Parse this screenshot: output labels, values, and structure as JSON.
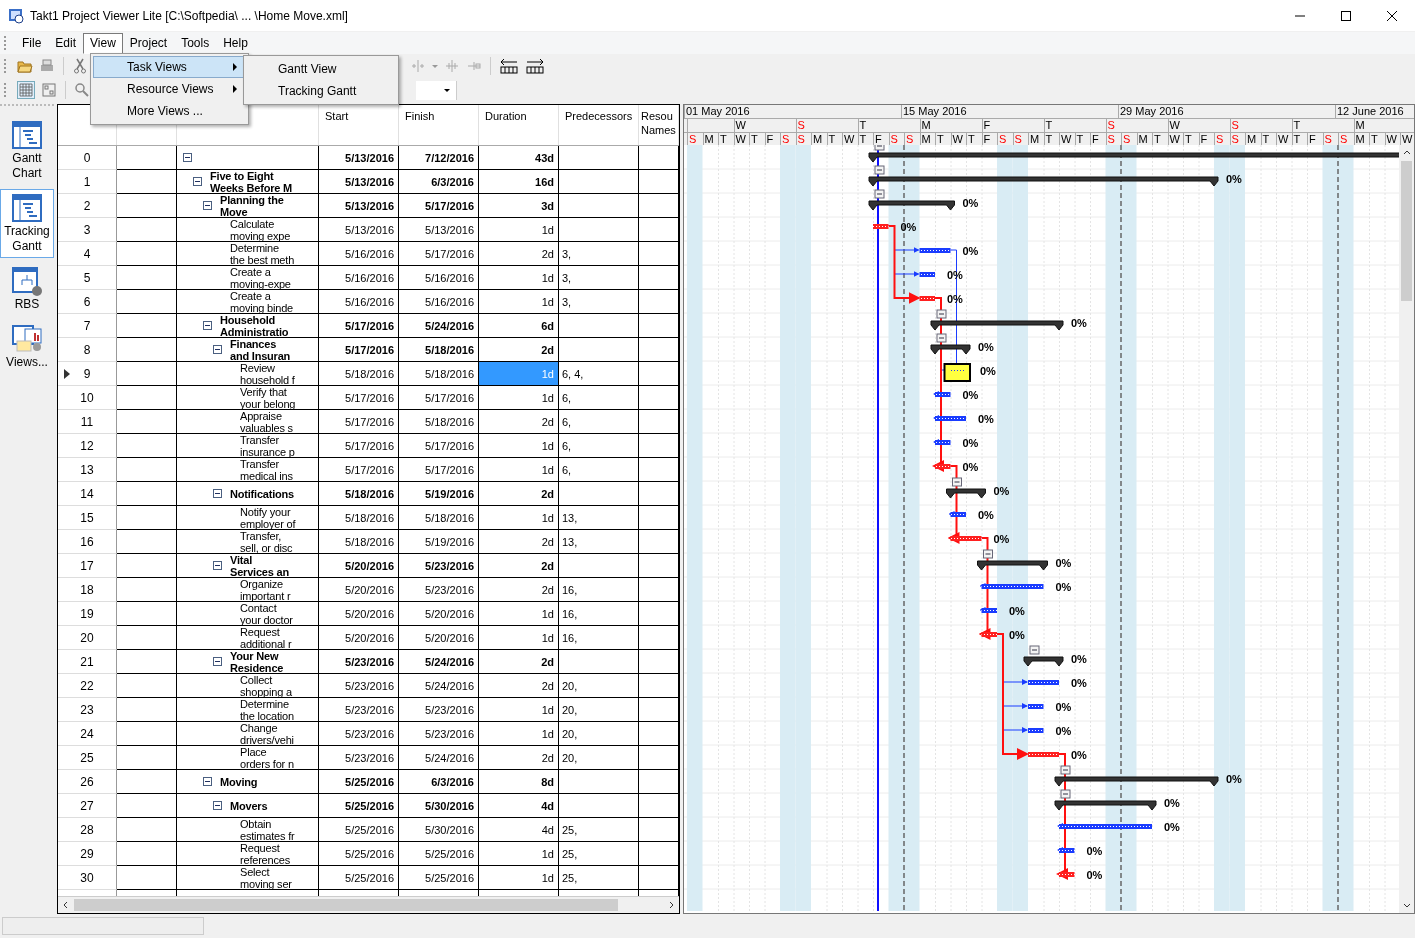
{
  "window": {
    "title": "Takt1 Project Viewer Lite [C:\\Softpedia\\ ... \\Home Move.xml]"
  },
  "menu": [
    {
      "label": "File",
      "selected": false
    },
    {
      "label": "Edit",
      "selected": false
    },
    {
      "label": "View",
      "selected": true
    },
    {
      "label": "Project",
      "selected": false
    },
    {
      "label": "Tools",
      "selected": false
    },
    {
      "label": "Help",
      "selected": false
    }
  ],
  "view_menu": [
    {
      "label": "Task Views",
      "selected": true,
      "submenu": true
    },
    {
      "label": "Resource Views",
      "selected": false,
      "submenu": true
    },
    {
      "label": "More Views ...",
      "selected": false,
      "submenu": false
    }
  ],
  "task_views_submenu": [
    "Gantt View",
    "Tracking Gantt"
  ],
  "sidebar": [
    {
      "label": "Gantt Chart",
      "selected": false
    },
    {
      "label": "Tracking Gantt",
      "selected": true
    },
    {
      "label": "RBS",
      "selected": false
    },
    {
      "label": "Views...",
      "selected": false
    }
  ],
  "table": {
    "columns": [
      "Start",
      "Finish",
      "Duration",
      "Predecessors",
      "Resou\nNames"
    ],
    "rows": [
      {
        "id": "0",
        "kind": "summary",
        "start": "5/13/2016",
        "finish": "7/12/2016",
        "duration": "43d",
        "selected": false,
        "children": [
          {
            "id": "1",
            "kind": "summary",
            "name": "Five to Eight\nWeeks Before M",
            "start": "5/13/2016",
            "finish": "6/3/2016",
            "duration": "16d",
            "progress": "0%",
            "selected": false,
            "children": [
              {
                "id": "2",
                "kind": "summary",
                "name": "Planning the\nMove",
                "start": "5/13/2016",
                "finish": "5/17/2016",
                "duration": "3d",
                "progress": "0%",
                "selected": false,
                "children": [
                  {
                    "id": "3",
                    "kind": "task",
                    "name": "Calculate\nmoving expe",
                    "start": "5/13/2016",
                    "finish": "5/13/2016",
                    "duration": "1d",
                    "progress": "0%",
                    "critical": true,
                    "selected": false
                  },
                  {
                    "id": "4",
                    "kind": "task",
                    "name": "Determine\nthe best meth",
                    "start": "5/16/2016",
                    "finish": "5/17/2016",
                    "duration": "2d",
                    "predecessors": "3,",
                    "progress": "0%",
                    "critical": false,
                    "selected": false
                  },
                  {
                    "id": "5",
                    "kind": "task",
                    "name": "Create a\nmoving-expe",
                    "start": "5/16/2016",
                    "finish": "5/16/2016",
                    "duration": "1d",
                    "predecessors": "3,",
                    "progress": "0%",
                    "critical": false,
                    "selected": false
                  },
                  {
                    "id": "6",
                    "kind": "task",
                    "name": "Create a\nmoving binde",
                    "start": "5/16/2016",
                    "finish": "5/16/2016",
                    "duration": "1d",
                    "predecessors": "3,",
                    "progress": "0%",
                    "critical": true,
                    "selected": false
                  }
                ]
              },
              {
                "id": "7",
                "kind": "summary",
                "name": "Household\nAdministratio",
                "start": "5/17/2016",
                "finish": "5/24/2016",
                "duration": "6d",
                "progress": "0%",
                "selected": false,
                "children": [
                  {
                    "id": "8",
                    "kind": "summary",
                    "name": "Finances\nand Insuran",
                    "start": "5/17/2016",
                    "finish": "5/18/2016",
                    "duration": "2d",
                    "progress": "0%",
                    "selected": false,
                    "children": [
                      {
                        "id": "9",
                        "kind": "task",
                        "name": "Review\nhousehold f",
                        "start": "5/18/2016",
                        "finish": "5/18/2016",
                        "duration": "1d",
                        "predecessors": "6, 4,",
                        "progress": "0%",
                        "critical": false,
                        "selected": true
                      },
                      {
                        "id": "10",
                        "kind": "task",
                        "name": "Verify that\nyour belong",
                        "start": "5/17/2016",
                        "finish": "5/17/2016",
                        "duration": "1d",
                        "predecessors": "6,",
                        "progress": "0%",
                        "critical": false,
                        "selected": false
                      },
                      {
                        "id": "11",
                        "kind": "task",
                        "name": "Appraise\nvaluables s",
                        "start": "5/17/2016",
                        "finish": "5/18/2016",
                        "duration": "2d",
                        "predecessors": "6,",
                        "progress": "0%",
                        "critical": false,
                        "selected": false
                      },
                      {
                        "id": "12",
                        "kind": "task",
                        "name": "Transfer\ninsurance p",
                        "start": "5/17/2016",
                        "finish": "5/17/2016",
                        "duration": "1d",
                        "predecessors": "6,",
                        "progress": "0%",
                        "critical": false,
                        "selected": false
                      },
                      {
                        "id": "13",
                        "kind": "task",
                        "name": "Transfer\nmedical ins",
                        "start": "5/17/2016",
                        "finish": "5/17/2016",
                        "duration": "1d",
                        "predecessors": "6,",
                        "progress": "0%",
                        "critical": true,
                        "selected": false
                      }
                    ]
                  },
                  {
                    "id": "14",
                    "kind": "summary",
                    "name": "Notifications",
                    "start": "5/18/2016",
                    "finish": "5/19/2016",
                    "duration": "2d",
                    "progress": "0%",
                    "selected": false,
                    "children": [
                      {
                        "id": "15",
                        "kind": "task",
                        "name": "Notify your\nemployer of",
                        "start": "5/18/2016",
                        "finish": "5/18/2016",
                        "duration": "1d",
                        "predecessors": "13,",
                        "progress": "0%",
                        "critical": false,
                        "selected": false
                      },
                      {
                        "id": "16",
                        "kind": "task",
                        "name": "Transfer,\nsell, or disc",
                        "start": "5/18/2016",
                        "finish": "5/19/2016",
                        "duration": "2d",
                        "predecessors": "13,",
                        "progress": "0%",
                        "critical": true,
                        "selected": false
                      }
                    ]
                  },
                  {
                    "id": "17",
                    "kind": "summary",
                    "name": "Vital\nServices an",
                    "start": "5/20/2016",
                    "finish": "5/23/2016",
                    "duration": "2d",
                    "progress": "0%",
                    "selected": false,
                    "children": [
                      {
                        "id": "18",
                        "kind": "task",
                        "name": "Organize\nimportant r",
                        "start": "5/20/2016",
                        "finish": "5/23/2016",
                        "duration": "2d",
                        "predecessors": "16,",
                        "progress": "0%",
                        "critical": false,
                        "selected": false
                      },
                      {
                        "id": "19",
                        "kind": "task",
                        "name": "Contact\nyour doctor",
                        "start": "5/20/2016",
                        "finish": "5/20/2016",
                        "duration": "1d",
                        "predecessors": "16,",
                        "progress": "0%",
                        "critical": false,
                        "selected": false
                      },
                      {
                        "id": "20",
                        "kind": "task",
                        "name": "Request\nadditional r",
                        "start": "5/20/2016",
                        "finish": "5/20/2016",
                        "duration": "1d",
                        "predecessors": "16,",
                        "progress": "0%",
                        "critical": true,
                        "selected": false
                      }
                    ]
                  },
                  {
                    "id": "21",
                    "kind": "summary",
                    "name": "Your New\nResidence",
                    "start": "5/23/2016",
                    "finish": "5/24/2016",
                    "duration": "2d",
                    "progress": "0%",
                    "selected": false,
                    "children": [
                      {
                        "id": "22",
                        "kind": "task",
                        "name": "Collect\nshopping a",
                        "start": "5/23/2016",
                        "finish": "5/24/2016",
                        "duration": "2d",
                        "predecessors": "20,",
                        "progress": "0%",
                        "critical": false,
                        "selected": false
                      },
                      {
                        "id": "23",
                        "kind": "task",
                        "name": "Determine\nthe location",
                        "start": "5/23/2016",
                        "finish": "5/23/2016",
                        "duration": "1d",
                        "predecessors": "20,",
                        "progress": "0%",
                        "critical": false,
                        "selected": false
                      },
                      {
                        "id": "24",
                        "kind": "task",
                        "name": "Change\ndrivers/vehi",
                        "start": "5/23/2016",
                        "finish": "5/23/2016",
                        "duration": "1d",
                        "predecessors": "20,",
                        "progress": "0%",
                        "critical": false,
                        "selected": false
                      },
                      {
                        "id": "25",
                        "kind": "task",
                        "name": "Place\norders for n",
                        "start": "5/23/2016",
                        "finish": "5/24/2016",
                        "duration": "2d",
                        "predecessors": "20,",
                        "progress": "0%",
                        "critical": true,
                        "selected": false
                      }
                    ]
                  }
                ]
              },
              {
                "id": "26",
                "kind": "summary",
                "name": "Moving",
                "start": "5/25/2016",
                "finish": "6/3/2016",
                "duration": "8d",
                "progress": "0%",
                "selected": false,
                "children": [
                  {
                    "id": "27",
                    "kind": "summary",
                    "name": "Movers",
                    "start": "5/25/2016",
                    "finish": "5/30/2016",
                    "duration": "4d",
                    "progress": "0%",
                    "selected": false,
                    "children": [
                      {
                        "id": "28",
                        "kind": "task",
                        "name": "Obtain\nestimates fr",
                        "start": "5/25/2016",
                        "finish": "5/30/2016",
                        "duration": "4d",
                        "predecessors": "25,",
                        "progress": "0%",
                        "critical": false,
                        "selected": false
                      },
                      {
                        "id": "29",
                        "kind": "task",
                        "name": "Request\nreferences",
                        "start": "5/25/2016",
                        "finish": "5/25/2016",
                        "duration": "1d",
                        "predecessors": "25,",
                        "progress": "0%",
                        "critical": false,
                        "selected": false
                      },
                      {
                        "id": "30",
                        "kind": "task",
                        "name": "Select\nmoving ser",
                        "start": "5/25/2016",
                        "finish": "5/25/2016",
                        "duration": "1d",
                        "predecessors": "25,",
                        "progress": "0%",
                        "critical": true,
                        "selected": false
                      }
                    ]
                  }
                ]
              }
            ]
          }
        ]
      }
    ]
  },
  "gantt": {
    "months": [
      "01 May 2016",
      "15 May 2016",
      "29 May 2016",
      "12 June 2016"
    ],
    "weeks": [
      {
        "label": "W",
        "weekend": false
      },
      {
        "label": "S",
        "weekend": true
      },
      {
        "label": "T",
        "weekend": false
      },
      {
        "label": "M",
        "weekend": false
      },
      {
        "label": "F",
        "weekend": false
      },
      {
        "label": "T",
        "weekend": false
      },
      {
        "label": "S",
        "weekend": true
      },
      {
        "label": "W",
        "weekend": false
      },
      {
        "label": "S",
        "weekend": true
      },
      {
        "label": "T",
        "weekend": false
      },
      {
        "label": "M",
        "weekend": false
      }
    ],
    "days": [
      {
        "label": "S",
        "weekend": true
      },
      {
        "label": "M",
        "weekend": false
      },
      {
        "label": "T",
        "weekend": false
      },
      {
        "label": "W",
        "weekend": false
      },
      {
        "label": "T",
        "weekend": false
      },
      {
        "label": "F",
        "weekend": false
      },
      {
        "label": "S",
        "weekend": true
      },
      {
        "label": "S",
        "weekend": true
      },
      {
        "label": "M",
        "weekend": false
      },
      {
        "label": "T",
        "weekend": false
      },
      {
        "label": "W",
        "weekend": false
      },
      {
        "label": "T",
        "weekend": false
      },
      {
        "label": "F",
        "weekend": false
      },
      {
        "label": "S",
        "weekend": true
      },
      {
        "label": "S",
        "weekend": true
      },
      {
        "label": "M",
        "weekend": false
      },
      {
        "label": "T",
        "weekend": false
      },
      {
        "label": "W",
        "weekend": false
      },
      {
        "label": "T",
        "weekend": false
      },
      {
        "label": "F",
        "weekend": false
      },
      {
        "label": "S",
        "weekend": true
      },
      {
        "label": "S",
        "weekend": true
      },
      {
        "label": "M",
        "weekend": false
      },
      {
        "label": "T",
        "weekend": false
      },
      {
        "label": "W",
        "weekend": false
      },
      {
        "label": "T",
        "weekend": false
      },
      {
        "label": "F",
        "weekend": false
      },
      {
        "label": "S",
        "weekend": true
      },
      {
        "label": "S",
        "weekend": true
      },
      {
        "label": "M",
        "weekend": false
      },
      {
        "label": "T",
        "weekend": false
      },
      {
        "label": "W",
        "weekend": false
      },
      {
        "label": "T",
        "weekend": false
      },
      {
        "label": "F",
        "weekend": false
      },
      {
        "label": "S",
        "weekend": true
      },
      {
        "label": "S",
        "weekend": true
      },
      {
        "label": "M",
        "weekend": false
      },
      {
        "label": "T",
        "weekend": false
      },
      {
        "label": "W",
        "weekend": false
      },
      {
        "label": "T",
        "weekend": false
      },
      {
        "label": "F",
        "weekend": false
      },
      {
        "label": "S",
        "weekend": true
      },
      {
        "label": "S",
        "weekend": true
      },
      {
        "label": "M",
        "weekend": false
      },
      {
        "label": "T",
        "weekend": false
      },
      {
        "label": "W",
        "weekend": false
      },
      {
        "label": "W",
        "weekend": false
      }
    ]
  }
}
